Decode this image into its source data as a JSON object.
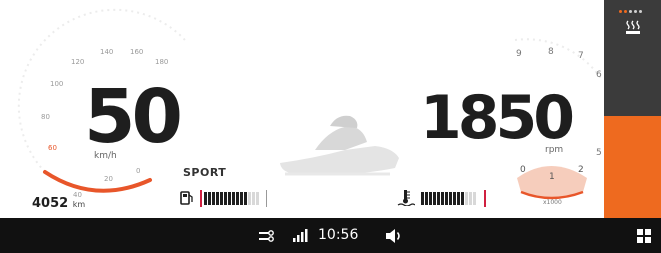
{
  "speed": {
    "value": "50",
    "unit": "km/h",
    "scale_labels": [
      "40",
      "20",
      "0",
      "60",
      "80",
      "100",
      "120",
      "140",
      "160",
      "180"
    ],
    "accent_color": "#e8562a"
  },
  "odometer": {
    "value": "4052",
    "unit": "km"
  },
  "mode": {
    "label": "SPORT"
  },
  "rpm": {
    "value": "1850",
    "unit": "rpm",
    "scale_labels": [
      "5",
      "6",
      "7",
      "8",
      "9"
    ],
    "unit_small": "x1000",
    "sub_labels": [
      "0",
      "1",
      "2"
    ],
    "accent_color": "#e8562a"
  },
  "fuel": {
    "icon": "fuel-pump-icon",
    "level": 0.75
  },
  "temperature": {
    "icon": "coolant-temperature-icon",
    "level": 0.75
  },
  "rail": {
    "accent_color": "#ee6a1f",
    "dark_color": "#3b3b3b",
    "icon": "heated-seat-icon"
  },
  "status_bar": {
    "time": "10:56",
    "icons": [
      "connection-icon",
      "signal-icon",
      "volume-icon",
      "apps-grid-icon"
    ]
  }
}
